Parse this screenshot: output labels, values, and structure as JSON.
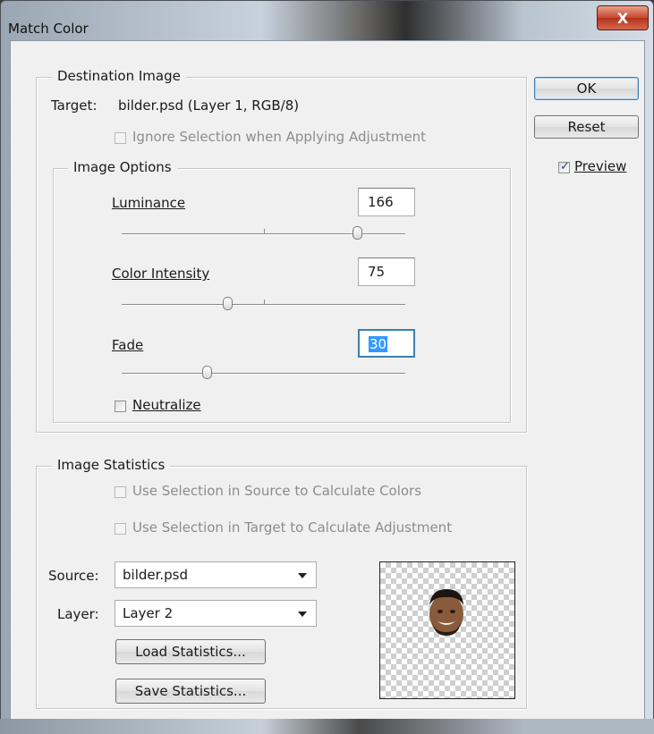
{
  "window": {
    "title": "Match Color",
    "close_glyph": "X"
  },
  "buttons": {
    "ok": "OK",
    "reset": "Reset",
    "load_statistics": "Load Statistics...",
    "save_statistics": "Save Statistics..."
  },
  "preview": {
    "label": "Preview",
    "checked": true
  },
  "destination": {
    "legend": "Destination Image",
    "target_label": "Target:",
    "target_value": "bilder.psd (Layer 1, RGB/8)",
    "ignore_selection_label": "Ignore Selection when Applying Adjustment"
  },
  "image_options": {
    "legend": "Image Options",
    "luminance": {
      "label": "Luminance",
      "value": "166",
      "slider_min": 1,
      "slider_max": 200
    },
    "color_intensity": {
      "label": "Color Intensity",
      "value": "75",
      "slider_min": 1,
      "slider_max": 200
    },
    "fade": {
      "label": "Fade",
      "value": "30",
      "slider_min": 0,
      "slider_max": 100
    },
    "neutralize": {
      "label": "Neutralize",
      "checked": false
    }
  },
  "statistics": {
    "legend": "Image Statistics",
    "use_selection_source": "Use Selection in Source to Calculate Colors",
    "use_selection_target": "Use Selection in Target to Calculate Adjustment",
    "source_label": "Source:",
    "source_value": "bilder.psd",
    "layer_label": "Layer:",
    "layer_value": "Layer 2"
  },
  "icons": {
    "close": "close-icon",
    "dropdown": "chevron-down-icon",
    "face": "face-thumbnail-icon"
  },
  "colors": {
    "dialog_bg": "#f0f0f0",
    "selection_highlight": "#3399ff",
    "close_button": "#c8462e"
  }
}
